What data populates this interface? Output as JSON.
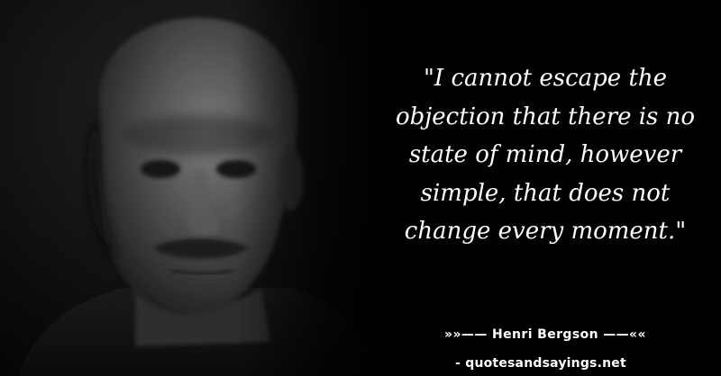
{
  "quote": {
    "lines": [
      "\"I cannot escape the",
      "objection that there is no",
      "state of mind, however",
      "simple, that does not",
      "change every moment.\""
    ]
  },
  "attribution": "»»—— Henri Bergson ——««",
  "website": "- quotesandsayings.net",
  "colors": {
    "background": "#000000",
    "text": "#ffffff"
  },
  "icons": {
    "portrait": "man-portrait-image"
  }
}
